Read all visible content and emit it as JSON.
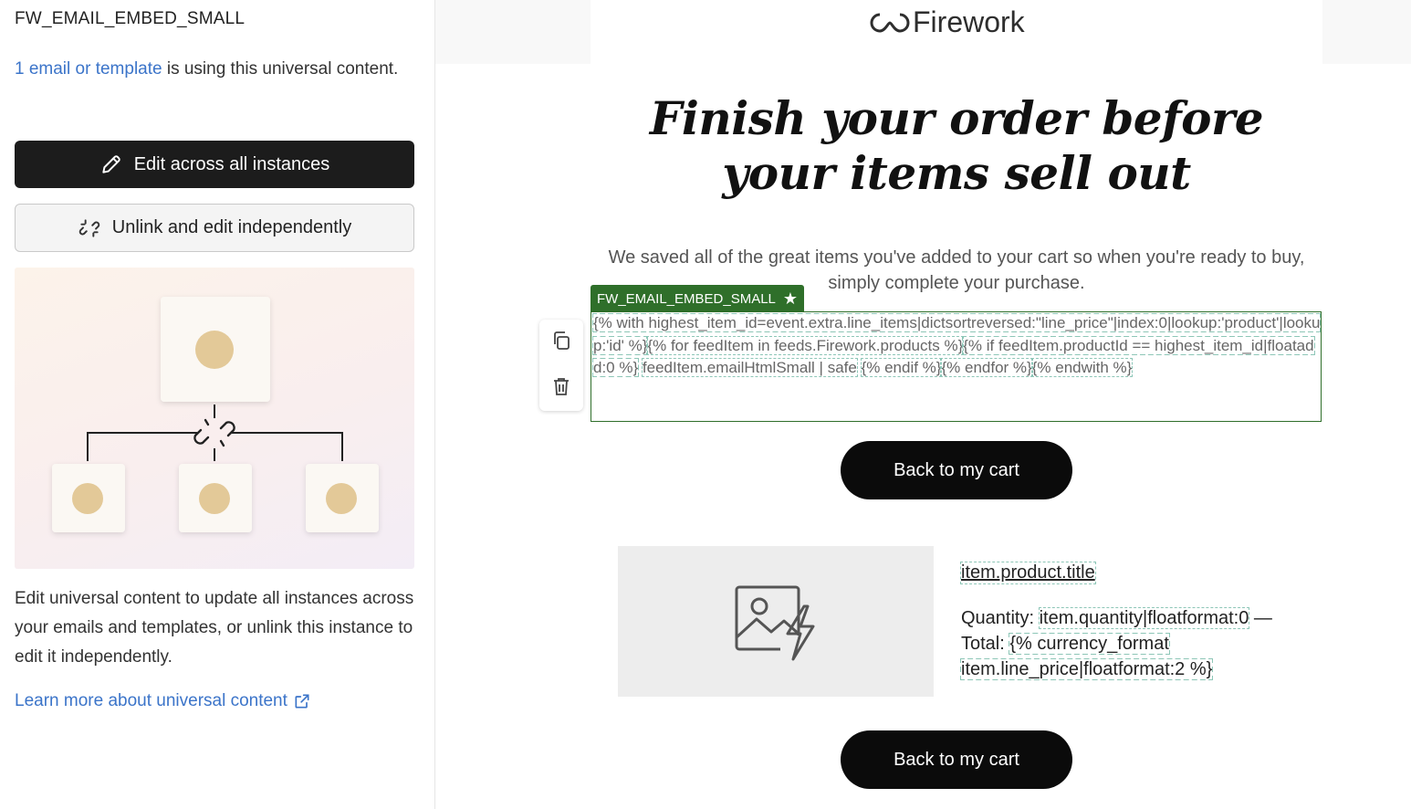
{
  "sidebar": {
    "title": "FW_EMAIL_EMBED_SMALL",
    "usage_link": "1 email or template",
    "usage_rest": " is using this universal content.",
    "edit_all_label": "Edit across all instances",
    "unlink_label": "Unlink and edit independently",
    "description": "Edit universal content to update all instances across your emails and templates, or unlink this instance to edit it independently.",
    "learn_more": "Learn more about universal content"
  },
  "email": {
    "logo_text": "Firework",
    "headline": "Finish your order before your items sell out",
    "body": "We saved all of the great items you've added to your cart so when you're ready to buy, simply complete your purchase.",
    "block_tag": "FW_EMAIL_EMBED_SMALL",
    "code_lines": [
      "{% with highest_item_id=event.extra.line_items|dictsortreversed:\"line_price\"|index:0|lookup:'product'|lookup:'id' %}",
      "{% for feedItem in feeds.Firework.products %}",
      "{% if feedItem.productId == highest_item_id|floatadd:0 %}",
      "feedItem.emailHtmlSmall | safe",
      "{% endif %}",
      "{% endfor %}",
      "{% endwith %}"
    ],
    "cta_label": "Back to my cart",
    "product_title": "item.product.title",
    "quantity_label": "Quantity: ",
    "quantity_value": "item.quantity|floatformat:0",
    "total_label": " — Total: ",
    "total_value": "{% currency_format item.line_price|floatformat:2 %}"
  },
  "colors": {
    "tag_green": "#2f6f2a",
    "link_blue": "#3b74c9",
    "button_dark": "#1c1c1c"
  }
}
